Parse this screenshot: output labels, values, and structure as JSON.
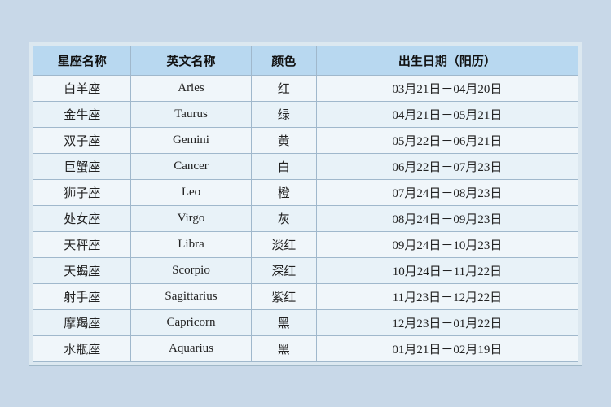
{
  "table": {
    "headers": [
      "星座名称",
      "英文名称",
      "颜色",
      "出生日期（阳历）"
    ],
    "rows": [
      {
        "zh": "白羊座",
        "en": "Aries",
        "color": "红",
        "date": "03月21日－04月20日"
      },
      {
        "zh": "金牛座",
        "en": "Taurus",
        "color": "绿",
        "date": "04月21日－05月21日"
      },
      {
        "zh": "双子座",
        "en": "Gemini",
        "color": "黄",
        "date": "05月22日－06月21日"
      },
      {
        "zh": "巨蟹座",
        "en": "Cancer",
        "color": "白",
        "date": "06月22日－07月23日"
      },
      {
        "zh": "狮子座",
        "en": "Leo",
        "color": "橙",
        "date": "07月24日－08月23日"
      },
      {
        "zh": "处女座",
        "en": "Virgo",
        "color": "灰",
        "date": "08月24日－09月23日"
      },
      {
        "zh": "天秤座",
        "en": "Libra",
        "color": "淡红",
        "date": "09月24日－10月23日"
      },
      {
        "zh": "天蝎座",
        "en": "Scorpio",
        "color": "深红",
        "date": "10月24日－11月22日"
      },
      {
        "zh": "射手座",
        "en": "Sagittarius",
        "color": "紫红",
        "date": "11月23日－12月22日"
      },
      {
        "zh": "摩羯座",
        "en": "Capricorn",
        "color": "黑",
        "date": "12月23日－01月22日"
      },
      {
        "zh": "水瓶座",
        "en": "Aquarius",
        "color": "黑",
        "date": "01月21日－02月19日"
      }
    ]
  }
}
